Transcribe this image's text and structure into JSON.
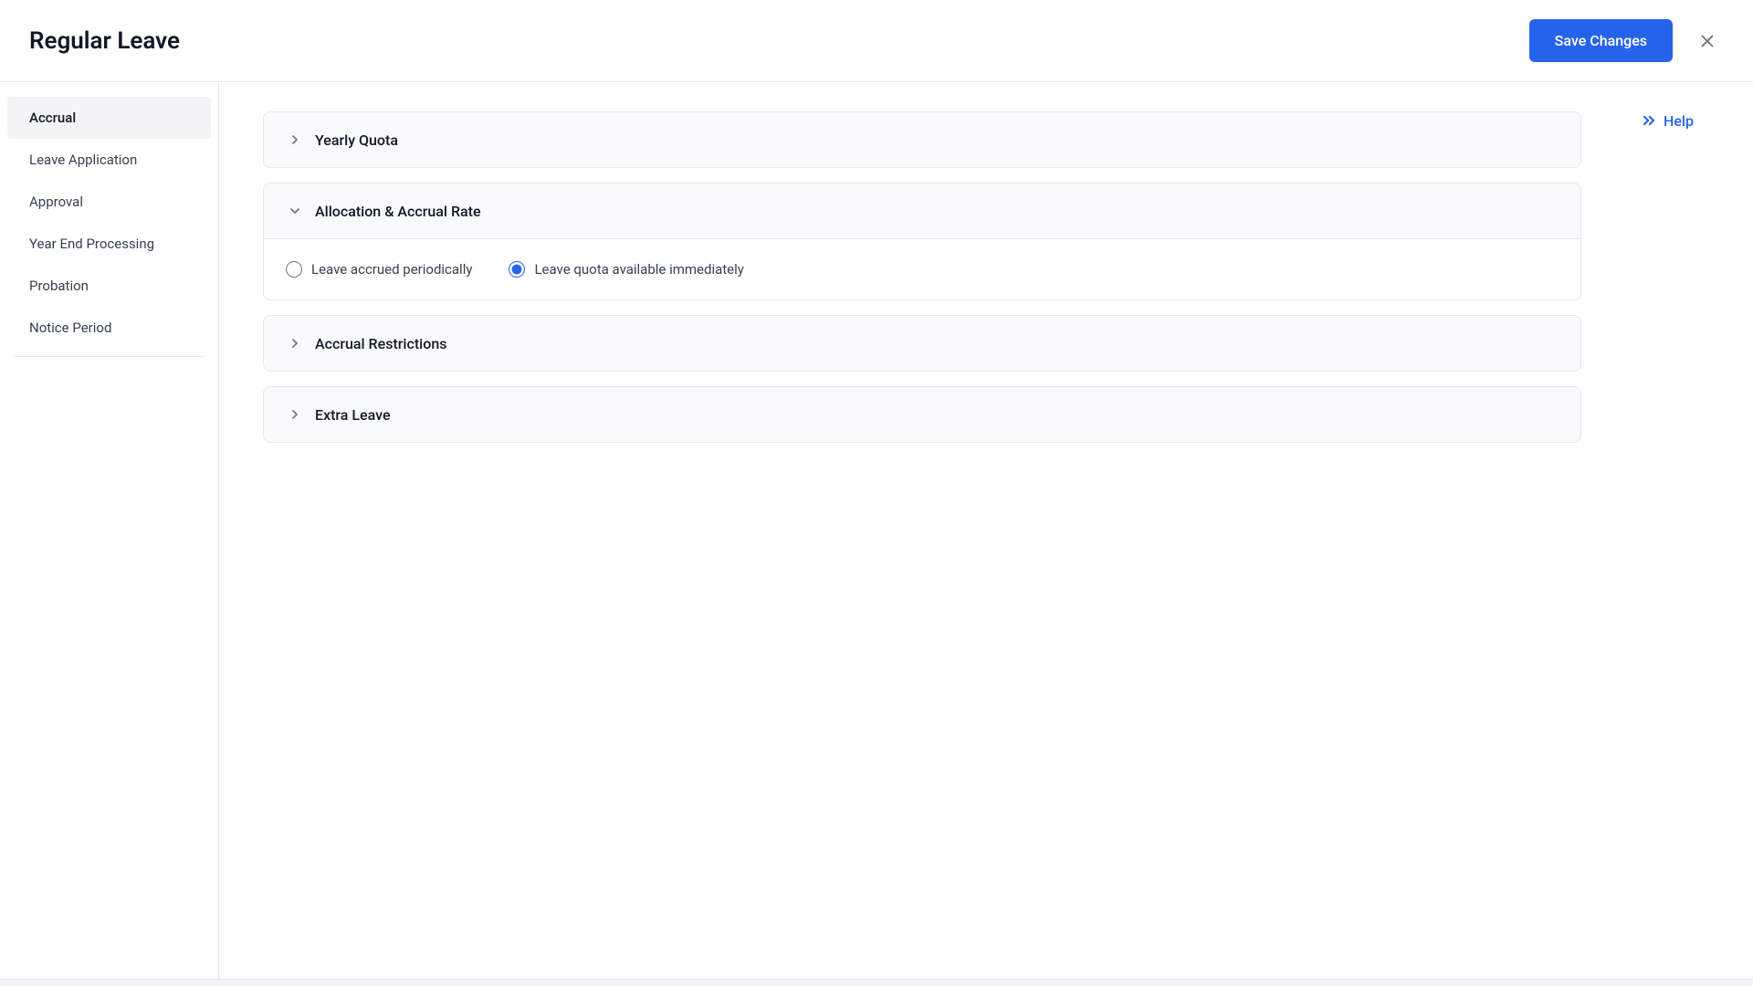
{
  "header": {
    "title": "Regular Leave",
    "save_button_label": "Save Changes",
    "close_icon": "×"
  },
  "sidebar": {
    "items": [
      {
        "id": "accrual",
        "label": "Accrual",
        "active": true
      },
      {
        "id": "leave-application",
        "label": "Leave Application",
        "active": false
      },
      {
        "id": "approval",
        "label": "Approval",
        "active": false
      },
      {
        "id": "year-end-processing",
        "label": "Year End Processing",
        "active": false
      },
      {
        "id": "probation",
        "label": "Probation",
        "active": false
      },
      {
        "id": "notice-period",
        "label": "Notice Period",
        "active": false
      }
    ]
  },
  "main": {
    "sections": [
      {
        "id": "yearly-quota",
        "title": "Yearly Quota",
        "expanded": false,
        "chevron_direction": "right"
      },
      {
        "id": "allocation-accrual-rate",
        "title": "Allocation & Accrual Rate",
        "expanded": true,
        "chevron_direction": "down",
        "content": {
          "radio_options": [
            {
              "id": "periodic",
              "label": "Leave accrued periodically",
              "checked": false
            },
            {
              "id": "immediate",
              "label": "Leave quota available immediately",
              "checked": true
            }
          ]
        }
      },
      {
        "id": "accrual-restrictions",
        "title": "Accrual Restrictions",
        "expanded": false,
        "chevron_direction": "right"
      },
      {
        "id": "extra-leave",
        "title": "Extra Leave",
        "expanded": false,
        "chevron_direction": "right"
      }
    ]
  },
  "help": {
    "label": "Help",
    "icon": ">>"
  },
  "colors": {
    "accent": "#2563eb",
    "active_sidebar_bg": "#f3f4f6"
  }
}
